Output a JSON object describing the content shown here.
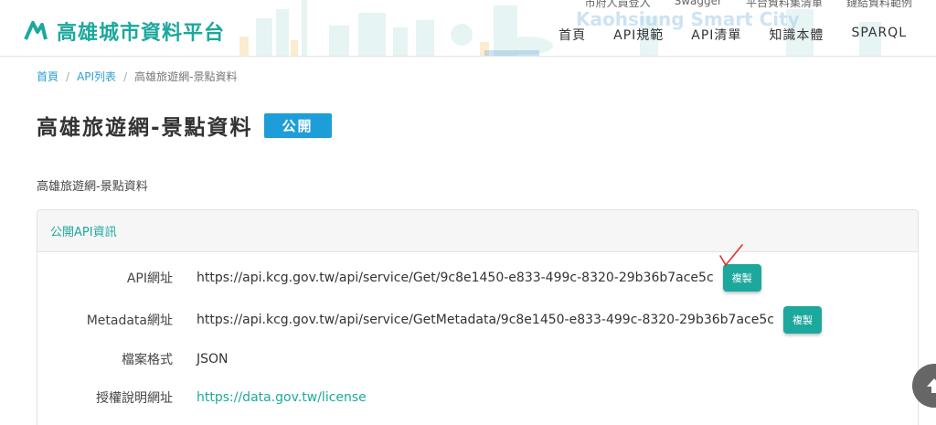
{
  "header": {
    "logo_text": "高雄城市資料平台",
    "top_links": [
      "市府人員登入",
      "Swagger",
      "平台資料集清單",
      "鏈結資料範例"
    ],
    "nav": [
      "首頁",
      "API規範",
      "API清單",
      "知識本體",
      "SPARQL"
    ],
    "background_text": "Kaohsiung Smart City"
  },
  "breadcrumb": {
    "home": "首頁",
    "api_list": "API列表",
    "current": "高雄旅遊網-景點資料"
  },
  "page": {
    "title": "高雄旅遊網-景點資料",
    "badge": "公開",
    "description": "高雄旅遊網-景點資料"
  },
  "panel": {
    "heading": "公開API資訊",
    "copy_label": "複製",
    "rows": [
      {
        "label": "API網址",
        "value": "https://api.kcg.gov.tw/api/service/Get/9c8e1450-e833-499c-8320-29b36b7ace5c"
      },
      {
        "label": "Metadata網址",
        "value": "https://api.kcg.gov.tw/api/service/GetMetadata/9c8e1450-e833-499c-8320-29b36b7ace5c"
      },
      {
        "label": "檔案格式",
        "value": "JSON"
      },
      {
        "label": "授權說明網址",
        "value": "https://data.gov.tw/license"
      }
    ]
  },
  "colors": {
    "brand": "#1da89d",
    "badge": "#1e9ed9",
    "link": "#2a9fd6"
  }
}
